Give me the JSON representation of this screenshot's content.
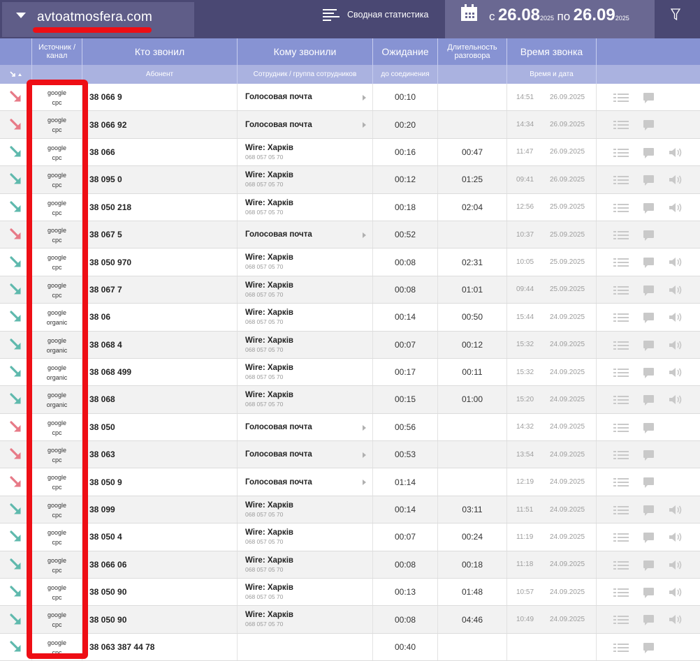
{
  "header": {
    "site": "avtoatmosfera.com",
    "summary_label": "Сводная статистика",
    "date_from_prefix": "с",
    "date_from": "26.08",
    "date_from_year": "2025",
    "date_to_prefix": "по",
    "date_to": "26.09",
    "date_to_year": "2025"
  },
  "columns": {
    "source": "Источник / канал",
    "caller": "Кто звонил",
    "callee": "Кому звонили",
    "wait": "Ожидание",
    "duration": "Длительность разговора",
    "time": "Время звонка"
  },
  "subheaders": {
    "caller": "Абонент",
    "callee": "Сотрудник / группа сотрудников",
    "wait": "до соединения",
    "time": "Время и дата"
  },
  "colors": {
    "missed": "#e77a87",
    "answered": "#5fb9ad",
    "highlight": "#ee0e15"
  },
  "rows": [
    {
      "status": "missed",
      "source": "google",
      "channel": "cpc",
      "caller": "38 066 9",
      "target": "Голосовая почта",
      "target_sub": "",
      "wait": "00:10",
      "duration": "",
      "time": "14:51",
      "date": "26.09.2025"
    },
    {
      "status": "missed",
      "source": "google",
      "channel": "cpc",
      "caller": "38 066 92",
      "target": "Голосовая почта",
      "target_sub": "",
      "wait": "00:20",
      "duration": "",
      "time": "14:34",
      "date": "26.09.2025"
    },
    {
      "status": "answered",
      "source": "google",
      "channel": "cpc",
      "caller": "38 066",
      "target": "Wire: Харків",
      "target_sub": "068 057 05 70",
      "wait": "00:16",
      "duration": "00:47",
      "time": "11:47",
      "date": "26.09.2025"
    },
    {
      "status": "answered",
      "source": "google",
      "channel": "cpc",
      "caller": "38 095 0",
      "target": "Wire: Харків",
      "target_sub": "068 057 05 70",
      "wait": "00:12",
      "duration": "01:25",
      "time": "09:41",
      "date": "26.09.2025"
    },
    {
      "status": "answered",
      "source": "google",
      "channel": "cpc",
      "caller": "38 050 218",
      "target": "Wire: Харків",
      "target_sub": "068 057 05 70",
      "wait": "00:18",
      "duration": "02:04",
      "time": "12:56",
      "date": "25.09.2025"
    },
    {
      "status": "missed",
      "source": "google",
      "channel": "cpc",
      "caller": "38 067 5",
      "target": "Голосовая почта",
      "target_sub": "",
      "wait": "00:52",
      "duration": "",
      "time": "10:37",
      "date": "25.09.2025"
    },
    {
      "status": "answered",
      "source": "google",
      "channel": "cpc",
      "caller": "38 050 970",
      "target": "Wire: Харків",
      "target_sub": "068 057 05 70",
      "wait": "00:08",
      "duration": "02:31",
      "time": "10:05",
      "date": "25.09.2025"
    },
    {
      "status": "answered",
      "source": "google",
      "channel": "cpc",
      "caller": "38 067 7",
      "target": "Wire: Харків",
      "target_sub": "068 057 05 70",
      "wait": "00:08",
      "duration": "01:01",
      "time": "09:44",
      "date": "25.09.2025"
    },
    {
      "status": "answered",
      "source": "google",
      "channel": "organic",
      "caller": "38 06",
      "target": "Wire: Харків",
      "target_sub": "068 057 05 70",
      "wait": "00:14",
      "duration": "00:50",
      "time": "15:44",
      "date": "24.09.2025"
    },
    {
      "status": "answered",
      "source": "google",
      "channel": "organic",
      "caller": "38 068 4",
      "target": "Wire: Харків",
      "target_sub": "068 057 05 70",
      "wait": "00:07",
      "duration": "00:12",
      "time": "15:32",
      "date": "24.09.2025"
    },
    {
      "status": "answered",
      "source": "google",
      "channel": "organic",
      "caller": "38 068 499",
      "target": "Wire: Харків",
      "target_sub": "068 057 05 70",
      "wait": "00:17",
      "duration": "00:11",
      "time": "15:32",
      "date": "24.09.2025"
    },
    {
      "status": "answered",
      "source": "google",
      "channel": "organic",
      "caller": "38 068",
      "target": "Wire: Харків",
      "target_sub": "068 057 05 70",
      "wait": "00:15",
      "duration": "01:00",
      "time": "15:20",
      "date": "24.09.2025"
    },
    {
      "status": "missed",
      "source": "google",
      "channel": "cpc",
      "caller": "38 050",
      "target": "Голосовая почта",
      "target_sub": "",
      "wait": "00:56",
      "duration": "",
      "time": "14:32",
      "date": "24.09.2025"
    },
    {
      "status": "missed",
      "source": "google",
      "channel": "cpc",
      "caller": "38 063",
      "target": "Голосовая почта",
      "target_sub": "",
      "wait": "00:53",
      "duration": "",
      "time": "13:54",
      "date": "24.09.2025"
    },
    {
      "status": "missed",
      "source": "google",
      "channel": "cpc",
      "caller": "38 050 9",
      "target": "Голосовая почта",
      "target_sub": "",
      "wait": "01:14",
      "duration": "",
      "time": "12:19",
      "date": "24.09.2025"
    },
    {
      "status": "answered",
      "source": "google",
      "channel": "cpc",
      "caller": "38 099",
      "target": "Wire: Харків",
      "target_sub": "068 057 05 70",
      "wait": "00:14",
      "duration": "03:11",
      "time": "11:51",
      "date": "24.09.2025"
    },
    {
      "status": "answered",
      "source": "google",
      "channel": "cpc",
      "caller": "38 050 4",
      "target": "Wire: Харків",
      "target_sub": "068 057 05 70",
      "wait": "00:07",
      "duration": "00:24",
      "time": "11:19",
      "date": "24.09.2025"
    },
    {
      "status": "answered",
      "source": "google",
      "channel": "cpc",
      "caller": "38 066 06",
      "target": "Wire: Харків",
      "target_sub": "068 057 05 70",
      "wait": "00:08",
      "duration": "00:18",
      "time": "11:18",
      "date": "24.09.2025"
    },
    {
      "status": "answered",
      "source": "google",
      "channel": "cpc",
      "caller": "38 050 90",
      "target": "Wire: Харків",
      "target_sub": "068 057 05 70",
      "wait": "00:13",
      "duration": "01:48",
      "time": "10:57",
      "date": "24.09.2025"
    },
    {
      "status": "answered",
      "source": "google",
      "channel": "cpc",
      "caller": "38 050 90",
      "target": "Wire: Харків",
      "target_sub": "068 057 05 70",
      "wait": "00:08",
      "duration": "04:46",
      "time": "10:49",
      "date": "24.09.2025"
    },
    {
      "status": "answered",
      "source": "google",
      "channel": "cpc",
      "caller": "38 063 387 44 78",
      "target": "",
      "target_sub": "",
      "wait": "00:40",
      "duration": "",
      "time": "",
      "date": ""
    }
  ]
}
